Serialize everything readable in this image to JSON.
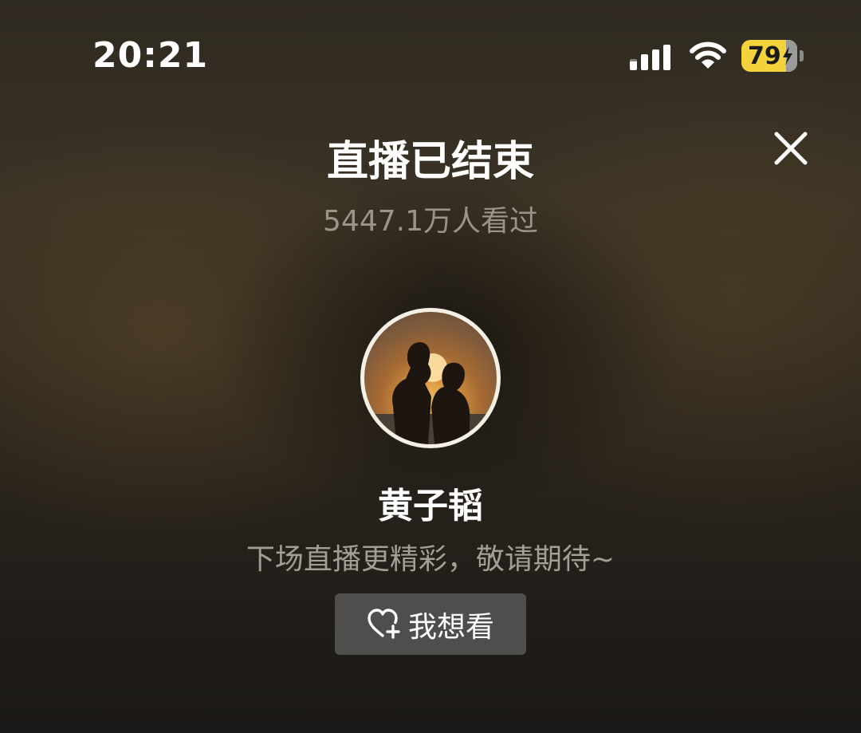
{
  "status_bar": {
    "time": "20:21",
    "battery_level": "79",
    "battery_color": "#f3d23c",
    "icons": [
      "signal-icon",
      "wifi-icon",
      "battery-icon",
      "charging-bolt-icon"
    ]
  },
  "header": {
    "title": "直播已结束",
    "close_icon": "close-icon"
  },
  "stats": {
    "views_text": "5447.1万人看过"
  },
  "streamer": {
    "avatar_icon": "avatar",
    "name": "黄子韬",
    "message": "下场直播更精彩，敬请期待~"
  },
  "action": {
    "want_label": "我想看",
    "want_icon": "heart-plus-icon"
  },
  "colors": {
    "text_primary": "#ffffff",
    "text_secondary": "#9a948a",
    "button_bg": "#5f5f5f"
  }
}
